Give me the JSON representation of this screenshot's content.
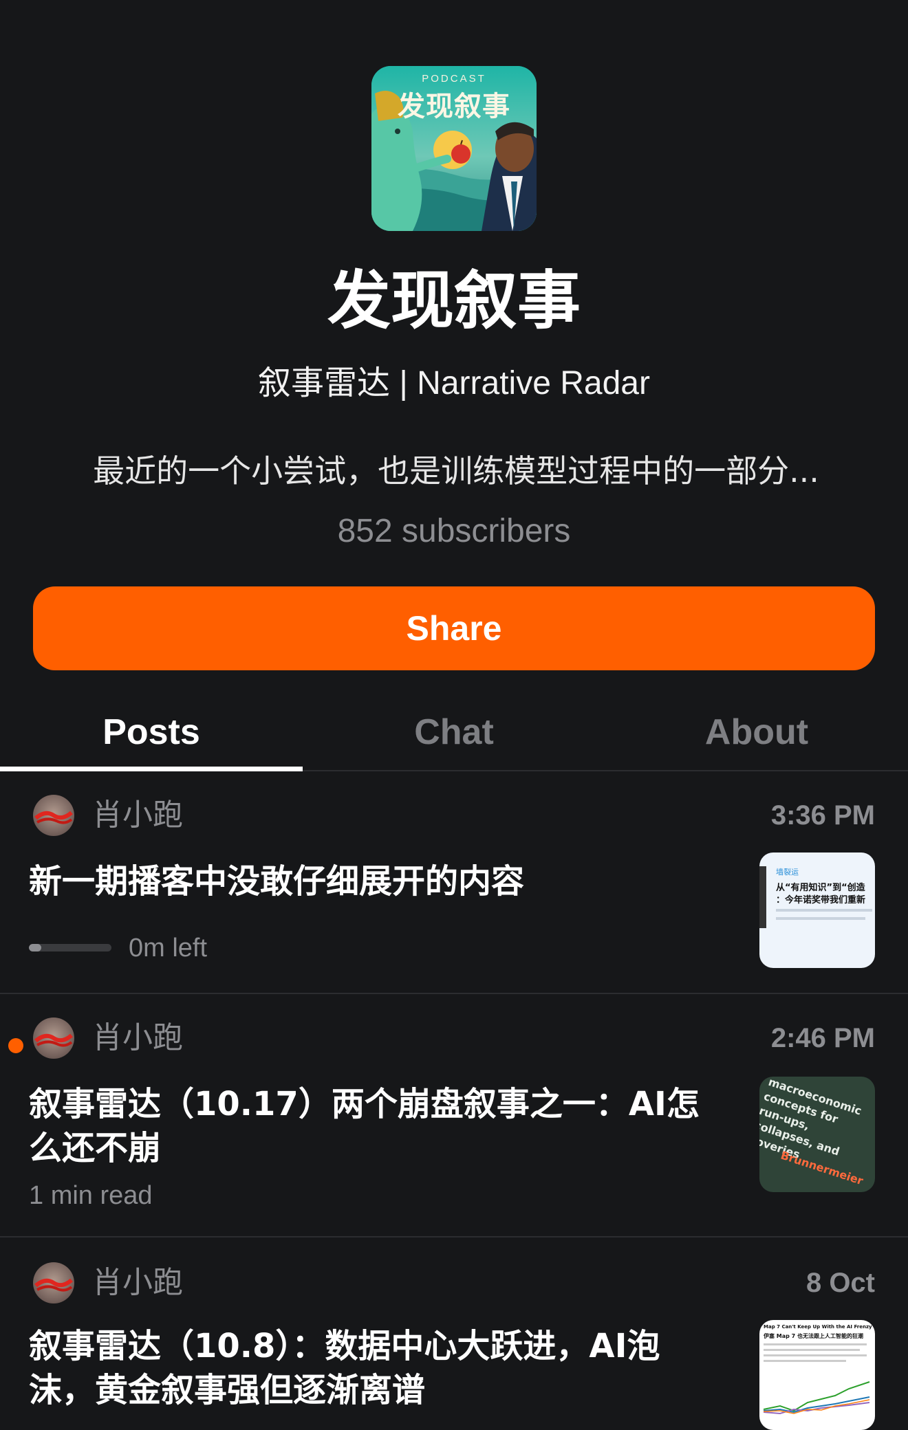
{
  "publication": {
    "cover_badge": "PODCAST",
    "cover_title": "发现叙事",
    "title": "发现叙事",
    "subtitle": "叙事雷达 | Narrative Radar",
    "description": "最近的一个小尝试，也是训练模型过程中的一部分...",
    "subscribers": "852 subscribers"
  },
  "share_button": {
    "label": "Share"
  },
  "tabs": [
    {
      "label": "Posts",
      "active": true
    },
    {
      "label": "Chat",
      "active": false
    },
    {
      "label": "About",
      "active": false
    }
  ],
  "posts": [
    {
      "author": "肖小跑",
      "time": "3:36 PM",
      "title": "新一期播客中没敢仔细展开的内容",
      "meta": "0m left",
      "progress": 0.15,
      "unread": false,
      "thumb_lines": [
        "墙裂运",
        "从“有用知识”到“创造",
        "：今年诺奖带我们重新"
      ]
    },
    {
      "author": "肖小跑",
      "time": "2:46 PM",
      "title": "叙事雷达（10.17）两个崩盘叙事之一：AI怎么还不崩",
      "meta": "1 min read",
      "unread": true,
      "thumb_lines": [
        "macroeconomic",
        "concepts for",
        "run-ups,",
        "collapses, and",
        "coveries",
        "Brunnermeier"
      ]
    },
    {
      "author": "肖小跑",
      "time": "8 Oct",
      "title": "叙事雷达（10.8）：数据中心大跃进，AI泡沫，黄金叙事强但逐渐离谱",
      "unread": false,
      "thumb_lines": [
        "Map 7 Can't Keep Up With the AI Frenzy",
        "伊塞 Map 7 也无法跟上人工智能的狂潮"
      ]
    }
  ],
  "colors": {
    "background": "#161719",
    "accent": "#ff5f00",
    "muted_text": "#8d8e92",
    "divider": "#2c2d30"
  }
}
